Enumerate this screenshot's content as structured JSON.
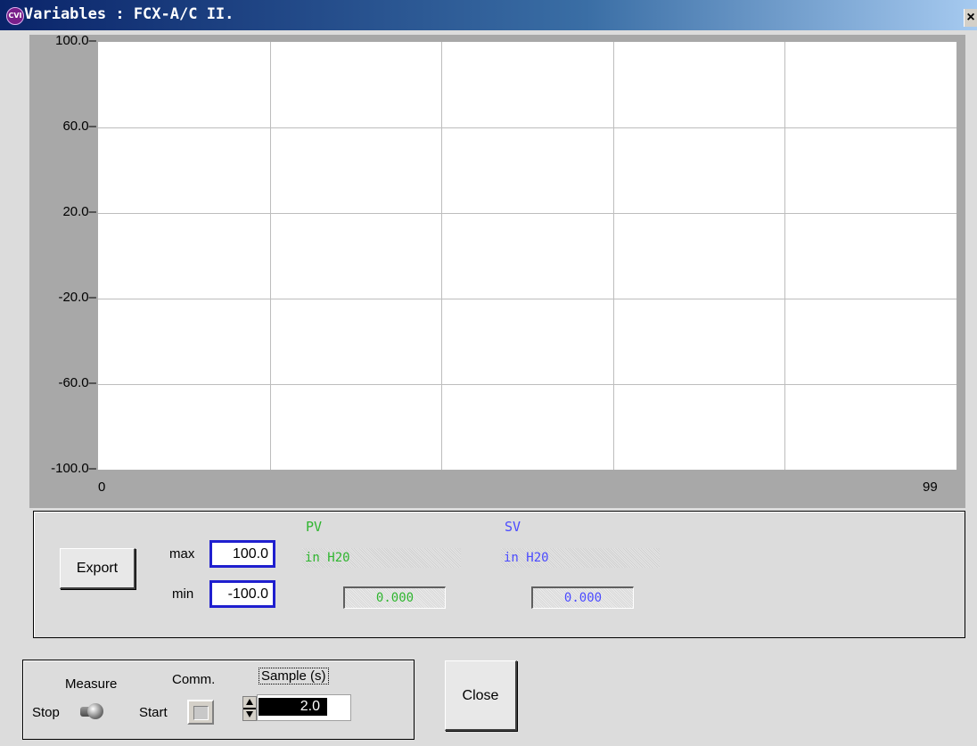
{
  "window": {
    "icon_text": "CVI",
    "title": "Variables : FCX-A/C II.",
    "close_glyph": "×"
  },
  "chart_data": {
    "type": "line",
    "ylim": [
      -100,
      100
    ],
    "xlim": [
      0,
      99
    ],
    "y_ticks": [
      "100.0",
      "60.0",
      "20.0",
      "-20.0",
      "-60.0",
      "-100.0"
    ],
    "x_ticks": [
      "0",
      "99"
    ],
    "grid": true,
    "series": []
  },
  "scale": {
    "export_label": "Export",
    "max_label": "max",
    "max_value": "100.0",
    "min_label": "min",
    "min_value": "-100.0"
  },
  "pv": {
    "label": "PV",
    "unit": "in H20",
    "value": "0.000",
    "color": "#2fb52f"
  },
  "sv": {
    "label": "SV",
    "unit": "in H20",
    "value": "0.000",
    "color": "#4b4bff"
  },
  "controls": {
    "measure_label": "Measure",
    "stop_label": "Stop",
    "comm_label": "Comm.",
    "start_label": "Start",
    "sample_label": "Sample (s)",
    "sample_value": "2.0",
    "close_label": "Close"
  }
}
